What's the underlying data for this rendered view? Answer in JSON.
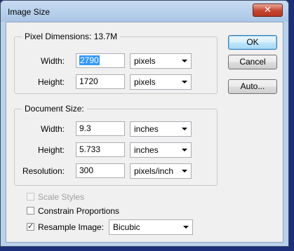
{
  "window": {
    "title": "Image Size"
  },
  "pixel_dimensions": {
    "label": "Pixel Dimensions:",
    "size": "13.7M",
    "width": {
      "label": "Width:",
      "value": "2790",
      "unit": "pixels"
    },
    "height": {
      "label": "Height:",
      "value": "1720",
      "unit": "pixels"
    }
  },
  "document_size": {
    "label": "Document Size:",
    "width": {
      "label": "Width:",
      "value": "9.3",
      "unit": "inches"
    },
    "height": {
      "label": "Height:",
      "value": "5.733",
      "unit": "inches"
    },
    "resolution": {
      "label": "Resolution:",
      "value": "300",
      "unit": "pixels/inch"
    }
  },
  "buttons": {
    "ok": "OK",
    "cancel": "Cancel",
    "auto": "Auto..."
  },
  "options": {
    "scale_styles": {
      "label": "Scale Styles",
      "checked": false,
      "enabled": false
    },
    "constrain": {
      "label": "Constrain Proportions",
      "checked": false
    },
    "resample": {
      "label": "Resample Image:",
      "checked": true,
      "method": "Bicubic"
    }
  }
}
